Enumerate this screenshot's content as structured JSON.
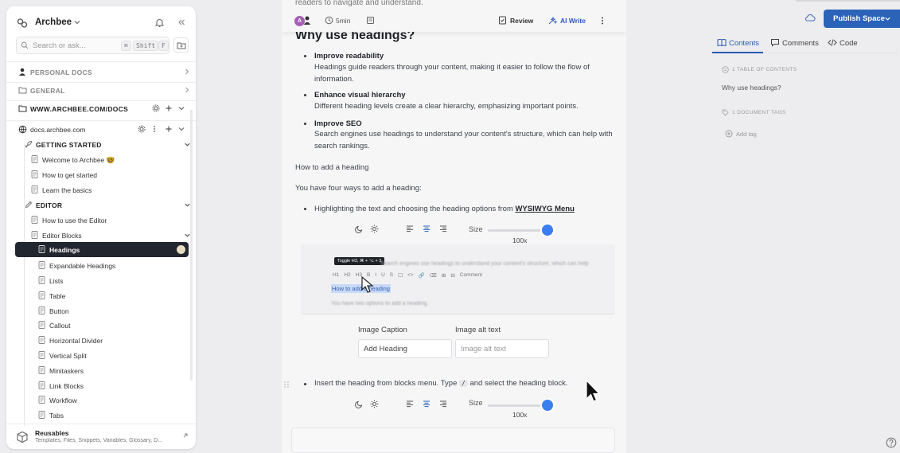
{
  "sidebar": {
    "workspace_name": "Archbee",
    "search_placeholder": "Search or ask...",
    "search_kbd_1": "⌘",
    "search_kbd_2": "Shift",
    "search_kbd_3": "F",
    "sections": [
      {
        "label": "PERSONAL DOCS"
      },
      {
        "label": "GENERAL"
      },
      {
        "label": "WWW.ARCHBEE.COM/DOCS"
      }
    ],
    "site": "docs.archbee.com",
    "getting_started": "GETTING STARTED",
    "gs_items": [
      "Welcome to Archbee 🤓",
      "How to get started",
      "Learn the basics"
    ],
    "editor_group": "EDITOR",
    "editor_items": [
      "How to use the Editor",
      "Editor Blocks"
    ],
    "block_items": [
      "Headings",
      "Expandable Headings",
      "Lists",
      "Table",
      "Button",
      "Callout",
      "Horizontal Divider",
      "Vertical Split",
      "Minitaskers",
      "Link Blocks",
      "Workflow",
      "Tabs"
    ],
    "reusables_title": "Reusables",
    "reusables_sub": "Templates, Files, Snippets, Variables, Glossary, D..."
  },
  "topbar": {
    "avatar_initial": "A",
    "read_time": "5min",
    "review_label": "Review",
    "ai_label": "AI Write"
  },
  "doc": {
    "faded_top": "readers to navigate and understand.",
    "heading": "Why use headings?",
    "bullets": [
      {
        "title": "Improve readability",
        "text": "Headings guide readers through your content, making it easier to follow the flow of information."
      },
      {
        "title": "Enhance visual hierarchy",
        "text": "Different heading levels create a clear hierarchy, emphasizing important points."
      },
      {
        "title": "Improve SEO",
        "text": "Search engines use headings to understand your content's structure, which can help with search rankings."
      }
    ],
    "p1": "How to add a heading",
    "p2": "You have four ways to add a heading:",
    "b4_text": "Highlighting the text and choosing the heading options from ",
    "b4_link": "WYSIWYG Menu",
    "size_label": "Size",
    "size_value": "100x",
    "img_tooltip": "Toggle H3, ⌘ + ⌥ + 3",
    "img_line1": "Search engines use headings to understand your content's structure, which can help",
    "img_toolbar": [
      "H1",
      "H2",
      "H3",
      "B",
      "I",
      "U",
      "S",
      "☐",
      "<>",
      "🔗",
      "⌫",
      "⊞",
      "⊟",
      "Comment"
    ],
    "img_selected": "How to add a heading",
    "img_line2": "You have two options to add a heading.",
    "caption_label": "Image Caption",
    "caption_value": "Add Heading",
    "alt_label": "Image alt text",
    "alt_placeholder": "Image alt text",
    "b5_text": "Insert the heading from blocks menu. Type ",
    "b5_code": "/",
    "b5_after": " and select the heading block."
  },
  "right_panel": {
    "publish_label": "Publish Space",
    "tab_contents": "Contents",
    "tab_comments": "Comments",
    "tab_code": "Code",
    "toc_label": "1 TABLE OF CONTENTS",
    "toc_item": "Why use headings?",
    "tags_label": "1 DOCUMENT TAGS",
    "add_tag": "Add tag"
  },
  "colors": {
    "accent": "#2a63b8",
    "active_item_bg": "#22262e",
    "ai_blue": "#2f55c9",
    "slider_knob": "#3b7ef0"
  }
}
